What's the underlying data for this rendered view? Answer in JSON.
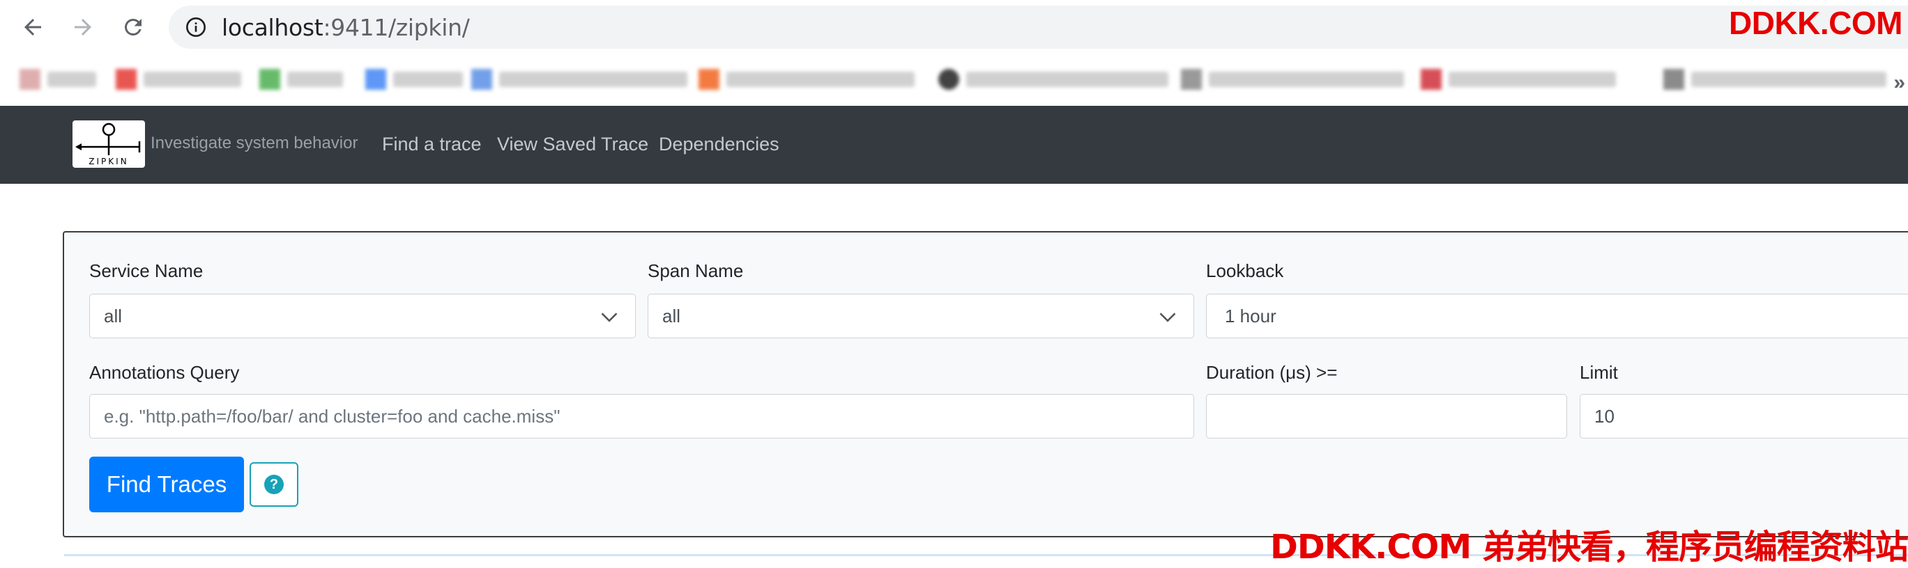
{
  "browser": {
    "url_host": "localhost",
    "url_rest": ":9411/zipkin/",
    "watermark": "DDKK.COM"
  },
  "bookmarks": {
    "items": [
      {
        "icon": "blurred-bookmark-icon",
        "color": "#d9a0a0"
      },
      {
        "icon": "blurred-bookmark-icon",
        "color": "#e53935"
      },
      {
        "icon": "blurred-bookmark-icon",
        "color": "#4caf50"
      },
      {
        "icon": "blurred-bookmark-icon",
        "color": "#4285f4"
      },
      {
        "icon": "blurred-bookmark-icon",
        "color": "#5a8fe6"
      },
      {
        "icon": "blurred-bookmark-icon",
        "color": "#f26522"
      },
      {
        "icon": "blurred-bookmark-icon",
        "color": "#222222"
      },
      {
        "icon": "blurred-bookmark-icon",
        "color": "#888888"
      },
      {
        "icon": "blurred-bookmark-icon",
        "color": "#d0303a"
      },
      {
        "icon": "blurred-bookmark-icon",
        "color": "#777777"
      }
    ]
  },
  "navbar": {
    "logo_text": "ZIPKIN",
    "tagline": "Investigate system behavior",
    "links": [
      "Find a trace",
      "View Saved Trace",
      "Dependencies"
    ]
  },
  "search": {
    "service_name": {
      "label": "Service Name",
      "value": "all"
    },
    "span_name": {
      "label": "Span Name",
      "value": "all"
    },
    "lookback": {
      "label": "Lookback",
      "value": "1 hour"
    },
    "annotations": {
      "label": "Annotations Query",
      "placeholder": "e.g. \"http.path=/foo/bar/ and cluster=foo and cache.miss\""
    },
    "duration": {
      "label": "Duration (μs) >=",
      "value": ""
    },
    "limit": {
      "label": "Limit",
      "value": "10"
    },
    "find_button": "Find Traces",
    "help_button": "?"
  },
  "watermark_bottom": "DDKK.COM 弟弟快看，程序员编程资料站",
  "colors": {
    "navbar_bg": "#343a40",
    "primary": "#007bff",
    "info": "#17a2b8",
    "watermark": "#e60000"
  }
}
